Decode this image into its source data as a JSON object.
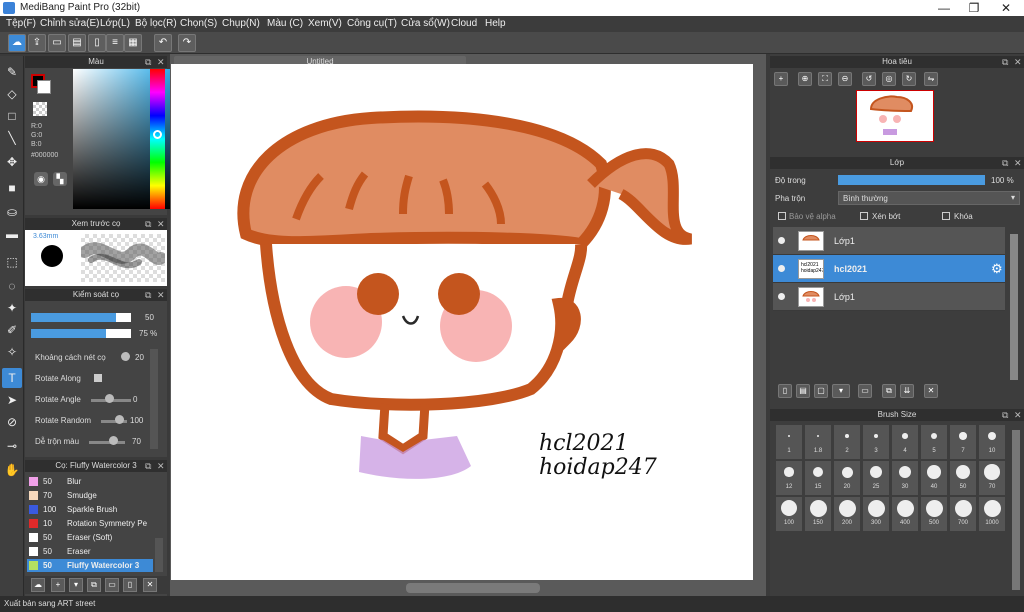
{
  "app": {
    "title": "MediBang Paint Pro (32bit)"
  },
  "menu": [
    "Tệp(F)",
    "Chỉnh sửa(E)",
    "Lớp(L)",
    "Bộ lọc(R)",
    "Chọn(S)",
    "Chụp(N)",
    "Màu (C)",
    "Xem(V)",
    "Công cụ(T)",
    "Cửa sổ(W)",
    "Cloud",
    "Help"
  ],
  "document": {
    "tab_title": "Untitled"
  },
  "color_panel": {
    "title": "Màu",
    "r": "R:0",
    "g": "G:0",
    "b": "B:0",
    "hex": "#000000",
    "fg": "#000000",
    "bg": "#ffffff"
  },
  "brush_preview": {
    "title": "Xem trước cọ",
    "size": "3.63mm"
  },
  "brush_control": {
    "title": "Kiểm soát cọ",
    "size_value": "50",
    "opacity_value": "75 %",
    "size_fill": 0.85,
    "opacity_fill": 0.75,
    "props": [
      {
        "label": "Khoảng cách nét cọ",
        "value": "20"
      },
      {
        "label": "Rotate Along",
        "value": ""
      },
      {
        "label": "Rotate Angle",
        "value": "0"
      },
      {
        "label": "Rotate Random",
        "value": "100"
      },
      {
        "label": "Dễ trộn màu",
        "value": "70"
      }
    ]
  },
  "brush_list": {
    "title": "Cọ: Fluffy Watercolor 3",
    "items": [
      {
        "size": "50",
        "name": "Blur",
        "color": "#f0a0e8"
      },
      {
        "size": "70",
        "name": "Smudge",
        "color": "#f6d8bc"
      },
      {
        "size": "100",
        "name": "Sparkle Brush",
        "color": "#3a5ae0"
      },
      {
        "size": "10",
        "name": "Rotation Symmetry Pe",
        "color": "#e02a2a"
      },
      {
        "size": "50",
        "name": "Eraser (Soft)",
        "color": "#ffffff"
      },
      {
        "size": "50",
        "name": "Eraser",
        "color": "#ffffff"
      },
      {
        "size": "50",
        "name": "Fluffy Watercolor 3",
        "color": "#b4e060"
      }
    ]
  },
  "canvas": {
    "text_line1": "hcl2021",
    "text_line2": "hoidap247",
    "thumb_text": "hcl2021 hoidap247",
    "hair_color": "#e08c62",
    "outline_color": "#c4551e",
    "cheek_color": "#f8b4b4",
    "shirt_color": "#c89ae0"
  },
  "navigator": {
    "title": "Hoa tiêu"
  },
  "layers": {
    "title": "Lớp",
    "opacity_label": "Độ trong",
    "opacity_value": "100 %",
    "opacity_fill": 1.0,
    "blend_label": "Pha trộn",
    "blend_value": "Bình thường",
    "protect_alpha": "Bảo vệ alpha",
    "clip": "Xén bớt",
    "lock": "Khóa",
    "items": [
      {
        "name": "Lớp1",
        "selected": false
      },
      {
        "name": "hcl2021",
        "selected": true
      },
      {
        "name": "Lớp1",
        "selected": false
      }
    ]
  },
  "brush_size": {
    "title": "Brush Size",
    "sizes": [
      "1",
      "1.8",
      "2",
      "3",
      "4",
      "5",
      "7",
      "10",
      "12",
      "15",
      "20",
      "25",
      "30",
      "40",
      "50",
      "70",
      "100",
      "150",
      "200",
      "300",
      "400",
      "500",
      "700",
      "1000"
    ]
  },
  "status": {
    "text": "Xuất bản sang ART street"
  },
  "accent": "#3d8ad6"
}
